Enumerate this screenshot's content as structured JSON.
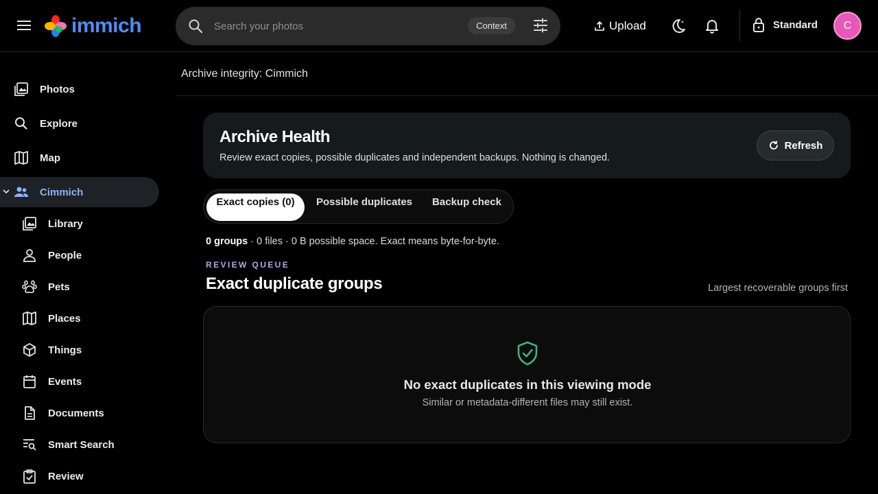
{
  "app": {
    "name": "immich"
  },
  "search": {
    "placeholder": "Search your photos",
    "context_label": "Context"
  },
  "header": {
    "upload_label": "Upload",
    "mode_label": "Standard",
    "avatar_initial": "C"
  },
  "sidebar": {
    "items": [
      {
        "label": "Photos",
        "icon": "photos-icon"
      },
      {
        "label": "Explore",
        "icon": "search-icon"
      },
      {
        "label": "Map",
        "icon": "map-icon"
      },
      {
        "label": "Cimmich",
        "icon": "people-group-icon",
        "active": true
      },
      {
        "label": "Library",
        "icon": "library-icon"
      },
      {
        "label": "People",
        "icon": "person-icon"
      },
      {
        "label": "Pets",
        "icon": "paw-icon"
      },
      {
        "label": "Places",
        "icon": "map-icon"
      },
      {
        "label": "Things",
        "icon": "cube-icon"
      },
      {
        "label": "Events",
        "icon": "calendar-icon"
      },
      {
        "label": "Documents",
        "icon": "document-icon"
      },
      {
        "label": "Smart Search",
        "icon": "smart-search-icon"
      },
      {
        "label": "Review",
        "icon": "clipboard-check-icon"
      }
    ]
  },
  "page": {
    "title": "Archive integrity: Cimmich"
  },
  "health": {
    "title": "Archive Health",
    "subtitle": "Review exact copies, possible duplicates and independent backups. Nothing is changed.",
    "refresh_label": "Refresh"
  },
  "tabs": [
    {
      "label": "Exact copies (0)",
      "selected": true
    },
    {
      "label": "Possible duplicates",
      "selected": false
    },
    {
      "label": "Backup check",
      "selected": false
    }
  ],
  "stats": {
    "groups": "0 groups",
    "rest": " · 0 files · 0 B possible space. Exact means byte-for-byte."
  },
  "review": {
    "eyebrow": "REVIEW QUEUE",
    "title": "Exact duplicate groups",
    "sort_note": "Largest recoverable groups first"
  },
  "empty": {
    "title": "No exact duplicates in this viewing mode",
    "subtitle": "Similar or metadata-different files may still exist."
  },
  "colors": {
    "accent": "#8ab4f8",
    "eyebrow": "#b9a3ea",
    "shield": "#3fb27f",
    "avatar": "#e858b8"
  }
}
